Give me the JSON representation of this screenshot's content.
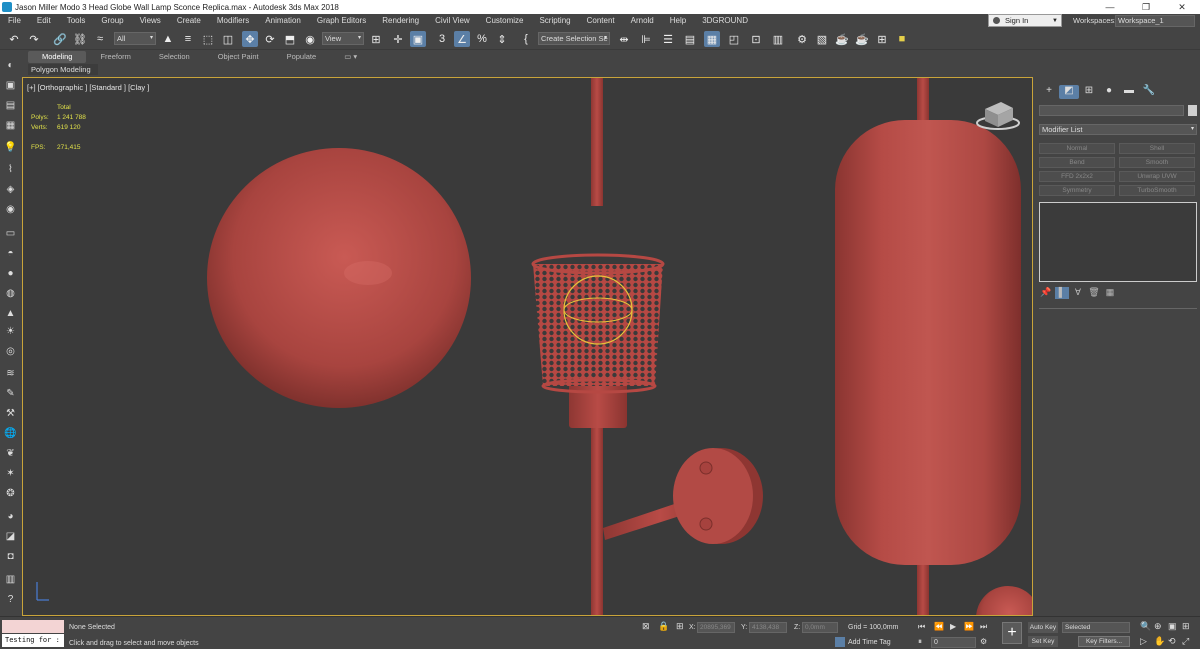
{
  "window": {
    "title": "Jason Miller Modo 3 Head Globe Wall Lamp Sconce Replica.max - Autodesk 3ds Max 2018",
    "controls": [
      "—",
      "❐",
      "✕"
    ]
  },
  "menu": {
    "items": [
      "File",
      "Edit",
      "Tools",
      "Group",
      "Views",
      "Create",
      "Modifiers",
      "Animation",
      "Graph Editors",
      "Rendering",
      "Civil View",
      "Customize",
      "Scripting",
      "Content",
      "Arnold",
      "Help",
      "3DGROUND"
    ],
    "sign_in": "Sign In",
    "workspaces_label": "Workspaces:",
    "workspace_value": "Workspace_1"
  },
  "toolbar": {
    "selection_filter": "All",
    "ref_coord": "View",
    "selection_set": "Create Selection Se"
  },
  "ribbon": {
    "tabs": [
      "Modeling",
      "Freeform",
      "Selection",
      "Object Paint",
      "Populate"
    ],
    "active_tab": "Modeling",
    "sub_label": "Polygon Modeling"
  },
  "viewport": {
    "label": "[+] [Orthographic ] [Standard ] [Clay ]",
    "stats": {
      "header": "Total",
      "polys_label": "Polys:",
      "polys_value": "1 241 788",
      "verts_label": "Verts:",
      "verts_value": "619 120",
      "fps_label": "FPS:",
      "fps_value": "271,415"
    },
    "model_color": "#c0504a",
    "bg_color": "#3a3a3a",
    "highlight_color": "#e6c23a"
  },
  "command_panel": {
    "modifier_list": "Modifier List",
    "modifier_buttons": [
      "Normal",
      "Shell",
      "Bend",
      "Smooth",
      "FFD 2x2x2",
      "Unwrap UVW",
      "Symmetry",
      "TurboSmooth"
    ]
  },
  "status": {
    "maxscript_input": "Testing for :",
    "selection": "None Selected",
    "prompt": "Click and drag to select and move objects",
    "x_label": "X:",
    "x_value": "20895,369",
    "y_label": "Y:",
    "y_value": "4138,438",
    "z_label": "Z:",
    "z_value": "0,0mm",
    "grid": "Grid = 100,0mm",
    "add_time_tag": "Add Time Tag",
    "frame": "0",
    "auto_key": "Auto Key",
    "set_key": "Set Key",
    "selected": "Selected",
    "key_filters": "Key Filters..."
  }
}
